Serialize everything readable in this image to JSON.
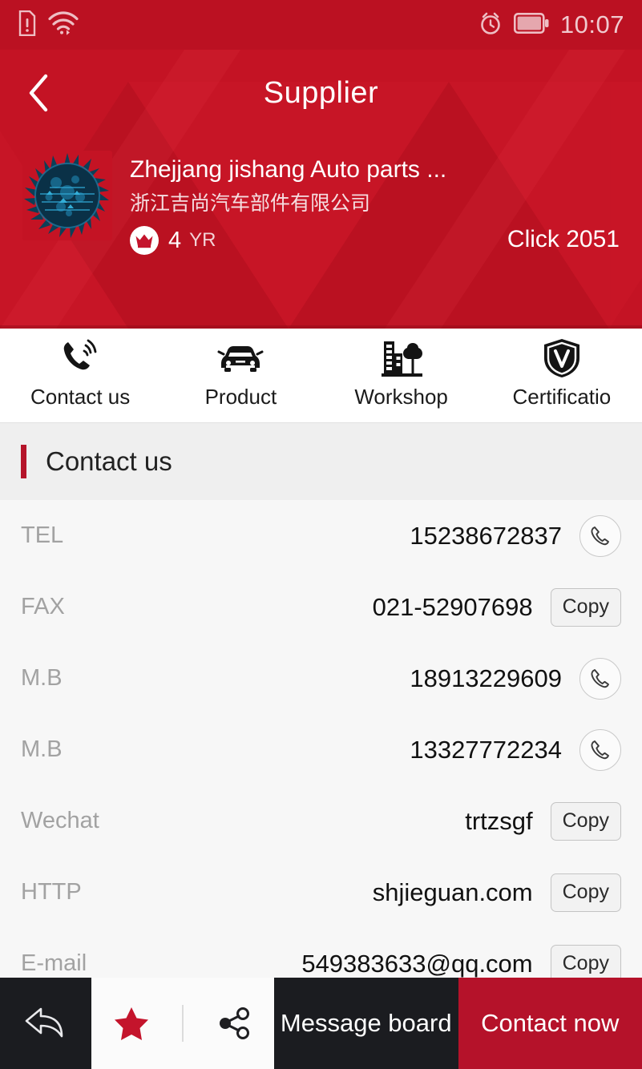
{
  "status_bar": {
    "time": "10:07",
    "icons": [
      "sdcard-warning-icon",
      "wifi-icon",
      "alarm-icon",
      "battery-icon"
    ]
  },
  "header": {
    "title": "Supplier",
    "back_icon": "chevron-left-icon",
    "background_color": "#c41324"
  },
  "supplier": {
    "logo_alt": "supplier-logo",
    "name": "Zhejjang jishang Auto parts ...",
    "name_cn": "浙江吉尚汽车部件有限公司",
    "badge_icon": "crown-icon",
    "years": "4",
    "years_unit": "YR",
    "clicks": "Click 2051"
  },
  "tabs": [
    {
      "label": "Contact us",
      "icon": "phone-ringing-icon",
      "active": true
    },
    {
      "label": "Product",
      "icon": "car-icon",
      "active": false
    },
    {
      "label": "Workshop",
      "icon": "factory-tree-icon",
      "active": false
    },
    {
      "label": "Certificatio",
      "icon": "shield-v-icon",
      "active": false
    }
  ],
  "section": {
    "title": "Contact us",
    "accent_color": "#b5142a"
  },
  "contacts": [
    {
      "label": "TEL",
      "value": "15238672837",
      "action": "call",
      "action_label": ""
    },
    {
      "label": "FAX",
      "value": "021-52907698",
      "action": "copy",
      "action_label": "Copy"
    },
    {
      "label": "M.B",
      "value": "18913229609",
      "action": "call",
      "action_label": ""
    },
    {
      "label": "M.B",
      "value": "13327772234",
      "action": "call",
      "action_label": ""
    },
    {
      "label": "Wechat",
      "value": "trtzsgf",
      "action": "copy",
      "action_label": "Copy"
    },
    {
      "label": "HTTP",
      "value": "shjieguan.com",
      "action": "copy",
      "action_label": "Copy"
    },
    {
      "label": "E-mail",
      "value": "549383633@qq.com",
      "action": "copy",
      "action_label": "Copy"
    }
  ],
  "bottom_bar": {
    "back_icon": "reply-arrow-icon",
    "favorite_icon": "star-filled-icon",
    "favorite_color": "#c4142c",
    "share_icon": "share-nodes-icon",
    "message_label": "Message board",
    "contact_label": "Contact now",
    "contact_color": "#b5122a"
  }
}
